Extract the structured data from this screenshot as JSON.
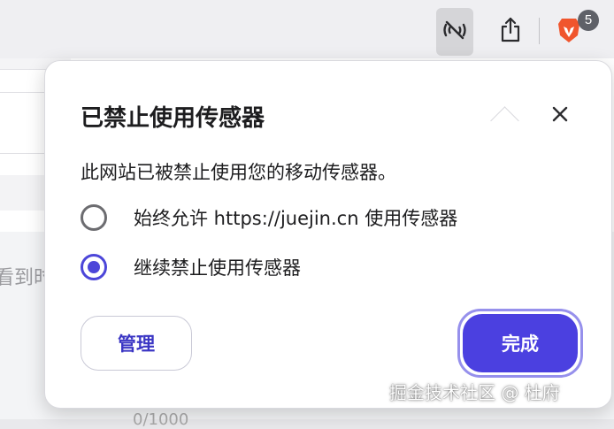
{
  "toolbar": {
    "sensor_icon": "sensor-blocked-icon",
    "share_icon": "share-icon",
    "brave_icon": "brave-lion-icon",
    "brave_badge_count": "5"
  },
  "page": {
    "hint_text": "看到时",
    "counter_text": "0/1000"
  },
  "popup": {
    "title": "已禁止使用传感器",
    "description": "此网站已被禁止使用您的移动传感器。",
    "options": [
      {
        "label": "始终允许 https://juejin.cn 使用传感器",
        "selected": false
      },
      {
        "label": "继续禁止使用传感器",
        "selected": true
      }
    ],
    "manage_label": "管理",
    "done_label": "完成",
    "accent_color": "#4b40e0"
  },
  "watermark": "掘金技术社区 @ 杜府"
}
